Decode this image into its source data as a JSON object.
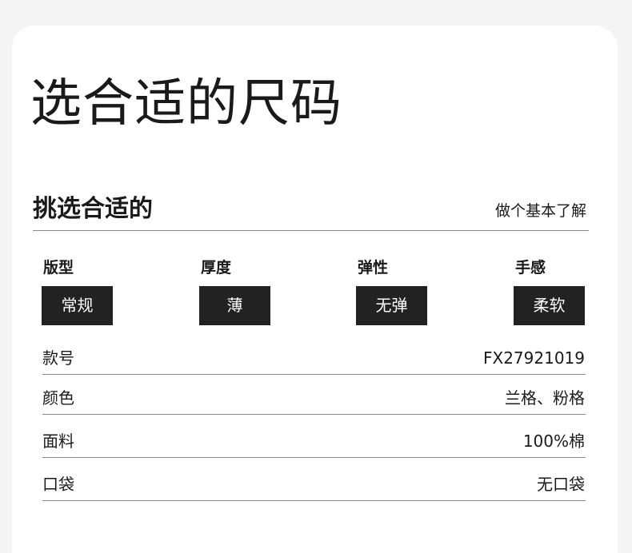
{
  "page": {
    "title": "选合适的尺码"
  },
  "section": {
    "title": "挑选合适的",
    "link": "做个基本了解"
  },
  "attributes": [
    {
      "label": "版型",
      "value": "常规"
    },
    {
      "label": "厚度",
      "value": "薄"
    },
    {
      "label": "弹性",
      "value": "无弹"
    },
    {
      "label": "手感",
      "value": "柔软"
    }
  ],
  "specs": [
    {
      "label": "款号",
      "value": "FX27921019"
    },
    {
      "label": "颜色",
      "value": "兰格、粉格"
    },
    {
      "label": "面料",
      "value": "100%棉"
    },
    {
      "label": "口袋",
      "value": "无口袋"
    }
  ],
  "colors": {
    "background": "#f4f4f4",
    "card": "#ffffff",
    "value_box": "#222222",
    "divider": "#8a8a8a"
  }
}
